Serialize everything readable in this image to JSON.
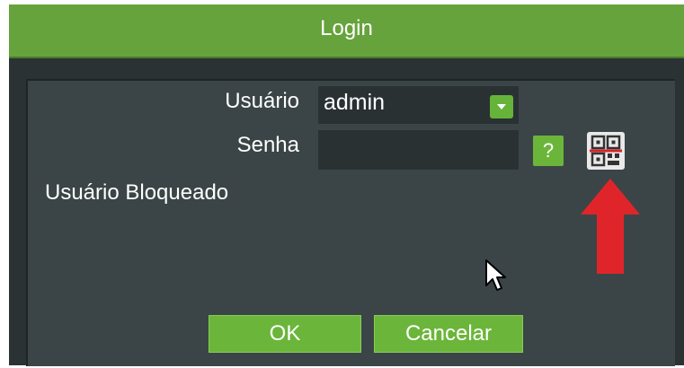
{
  "dialog": {
    "title": "Login"
  },
  "form": {
    "user_label": "Usuário",
    "user_value": "admin",
    "password_label": "Senha",
    "password_value": "",
    "help_label": "?",
    "status_text": "Usuário Bloqueado"
  },
  "buttons": {
    "ok_label": "OK",
    "cancel_label": "Cancelar"
  },
  "icons": {
    "dropdown": "chevron-down-icon",
    "qr": "qr-code-icon",
    "arrow": "arrow-up-icon",
    "cursor": "mouse-cursor-icon"
  },
  "colors": {
    "title_bar": "#66a33c",
    "button": "#6bb63a",
    "background": "#2b3234",
    "panel": "#3b4547",
    "arrow": "#e0252a",
    "qr_red": "#d8232a"
  }
}
